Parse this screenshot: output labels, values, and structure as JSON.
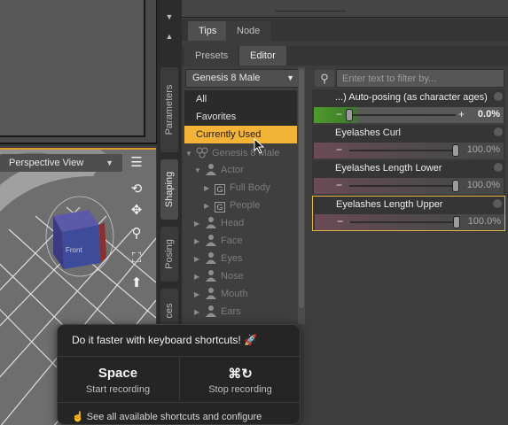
{
  "viewport": {
    "view_label": "Perspective View",
    "cube_label": "Front"
  },
  "side_tabs": [
    {
      "label": "Parameters"
    },
    {
      "label": "Shaping"
    },
    {
      "label": "Posing"
    },
    {
      "label": "ces"
    }
  ],
  "panel_tabs": [
    {
      "label": "Tips"
    },
    {
      "label": "Node"
    }
  ],
  "sub_tabs": [
    {
      "label": "Presets"
    },
    {
      "label": "Editor"
    }
  ],
  "figure_select": {
    "value": "Genesis 8 Male"
  },
  "menu": {
    "items": [
      {
        "label": "All"
      },
      {
        "label": "Favorites"
      },
      {
        "label": "Currently Used"
      }
    ]
  },
  "tree": [
    {
      "label": "Genesis 8 Male"
    },
    {
      "label": "Actor"
    },
    {
      "label": "Full Body"
    },
    {
      "label": "People"
    },
    {
      "label": "Head"
    },
    {
      "label": "Face"
    },
    {
      "label": "Eyes"
    },
    {
      "label": "Nose"
    },
    {
      "label": "Mouth"
    },
    {
      "label": "Ears"
    }
  ],
  "filter": {
    "placeholder": "Enter text to filter by..."
  },
  "properties": [
    {
      "label": "...) Auto-posing (as character ages)",
      "value_text": "0.0%",
      "value": 0.0
    },
    {
      "label": "Eyelashes Curl",
      "value_text": "100.0%",
      "value": 100.0
    },
    {
      "label": "Eyelashes Length Lower",
      "value_text": "100.0%",
      "value": 100.0
    },
    {
      "label": "Eyelashes Length Upper",
      "value_text": "100.0%",
      "value": 100.0
    }
  ],
  "popup": {
    "title": "Do it faster with keyboard shortcuts! 🚀",
    "left_key": "Space",
    "left_caption": "Start recording",
    "right_key": "⌘↻",
    "right_caption": "Stop recording",
    "footer": "☝ See all available shortcuts and configure"
  },
  "colors": {
    "accent": "#f2b336",
    "selected_border": "#e3b343",
    "viewport_border": "#d99a2a"
  }
}
